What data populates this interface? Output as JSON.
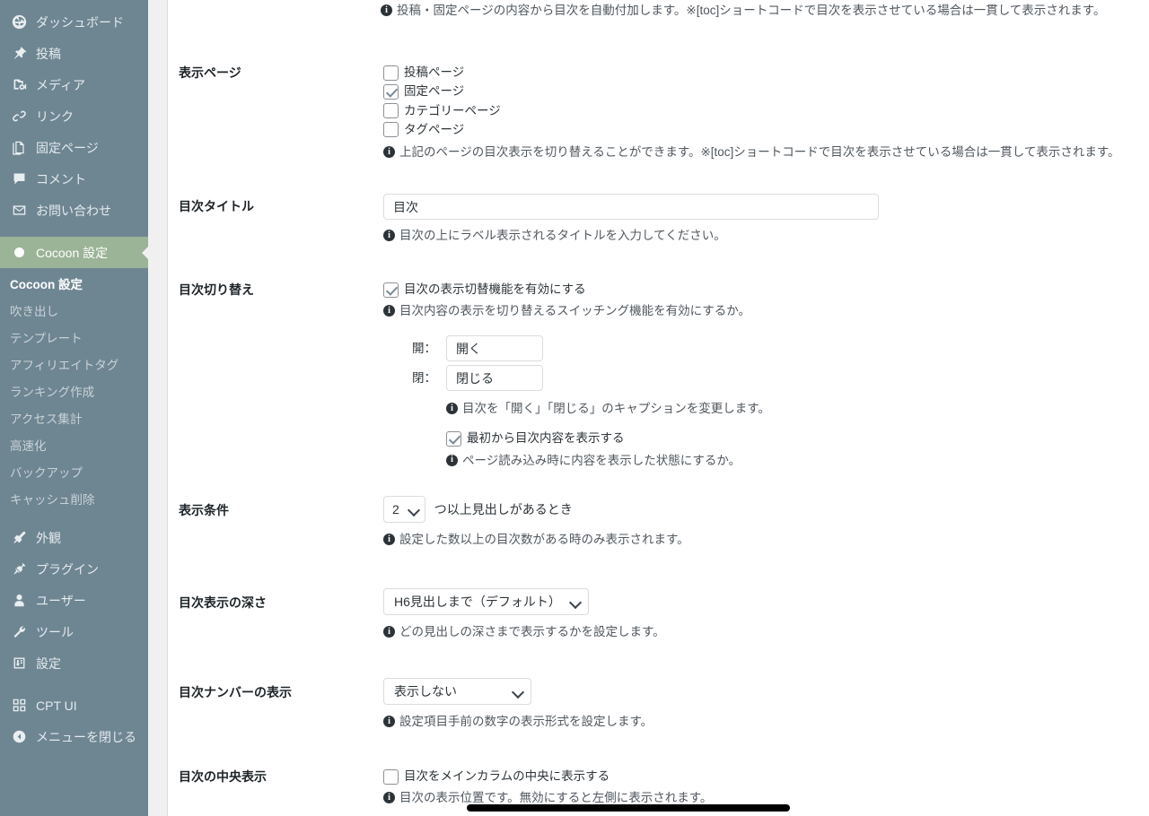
{
  "sidebar": {
    "items": [
      {
        "label": "ダッシュボード",
        "icon": "dashboard-icon"
      },
      {
        "label": "投稿",
        "icon": "pin-icon"
      },
      {
        "label": "メディア",
        "icon": "media-icon"
      },
      {
        "label": "リンク",
        "icon": "link-icon"
      },
      {
        "label": "固定ページ",
        "icon": "pages-icon"
      },
      {
        "label": "コメント",
        "icon": "comment-icon"
      },
      {
        "label": "お問い合わせ",
        "icon": "mail-icon"
      }
    ],
    "active_item": {
      "label": "Cocoon 設定",
      "icon": "cocoon-icon"
    },
    "submenu": [
      {
        "label": "Cocoon 設定",
        "current": true
      },
      {
        "label": "吹き出し",
        "current": false
      },
      {
        "label": "テンプレート",
        "current": false
      },
      {
        "label": "アフィリエイトタグ",
        "current": false
      },
      {
        "label": "ランキング作成",
        "current": false
      },
      {
        "label": "アクセス集計",
        "current": false
      },
      {
        "label": "高速化",
        "current": false
      },
      {
        "label": "バックアップ",
        "current": false
      },
      {
        "label": "キャッシュ削除",
        "current": false
      }
    ],
    "items_lower": [
      {
        "label": "外観",
        "icon": "appearance-icon"
      },
      {
        "label": "プラグイン",
        "icon": "plugin-icon"
      },
      {
        "label": "ユーザー",
        "icon": "user-icon"
      },
      {
        "label": "ツール",
        "icon": "tools-icon"
      },
      {
        "label": "設定",
        "icon": "settings-icon"
      }
    ],
    "items_last": [
      {
        "label": "CPT UI",
        "icon": "cpt-ui-icon"
      },
      {
        "label": "メニューを閉じる",
        "icon": "collapse-icon"
      }
    ],
    "colors": {
      "background": "#6e8692",
      "active_background": "#9bb396",
      "text": "#e4eaee"
    }
  },
  "main": {
    "top_desc": "投稿・固定ページの内容から目次を自動付加します。※[toc]ショートコードで目次を表示させている場合は一貫して表示されます。",
    "rows": {
      "display_pages": {
        "label": "表示ページ",
        "checkboxes": [
          {
            "label": "投稿ページ",
            "checked": false
          },
          {
            "label": "固定ページ",
            "checked": true
          },
          {
            "label": "カテゴリーページ",
            "checked": false
          },
          {
            "label": "タグページ",
            "checked": false
          }
        ],
        "desc": "上記のページの目次表示を切り替えることができます。※[toc]ショートコードで目次を表示させている場合は一貫して表示されます。"
      },
      "toc_title": {
        "label": "目次タイトル",
        "value": "目次",
        "placeholder": "目次",
        "desc": "目次の上にラベル表示されるタイトルを入力してください。"
      },
      "toc_toggle": {
        "label": "目次切り替え",
        "enable_checkbox": {
          "label": "目次の表示切替機能を有効にする",
          "checked": true
        },
        "enable_desc": "目次内容の表示を切り替えるスイッチング機能を有効にするか。",
        "open_caption": "開：",
        "open_value": "開く",
        "close_caption": "閉：",
        "close_value": "閉じる",
        "caption_desc": "目次を「開く」「閉じる」のキャプションを変更します。",
        "initial_checkbox": {
          "label": "最初から目次内容を表示する",
          "checked": true
        },
        "initial_desc": "ページ読み込み時に内容を表示した状態にするか。"
      },
      "display_condition": {
        "label": "表示条件",
        "select_value": "2",
        "after_text": "つ以上見出しがあるとき",
        "desc": "設定した数以上の目次数がある時のみ表示されます。"
      },
      "toc_depth": {
        "label": "目次表示の深さ",
        "select_value": "H6見出しまで（デフォルト）",
        "desc": "どの見出しの深さまで表示するかを設定します。"
      },
      "toc_number": {
        "label": "目次ナンバーの表示",
        "select_value": "表示しない",
        "desc": "設定項目手前の数字の表示形式を設定します。"
      },
      "toc_center": {
        "label": "目次の中央表示",
        "checkbox": {
          "label": "目次をメインカラムの中央に表示する",
          "checked": false
        },
        "desc": "目次の表示位置です。無効にすると左側に表示されます。"
      }
    }
  }
}
